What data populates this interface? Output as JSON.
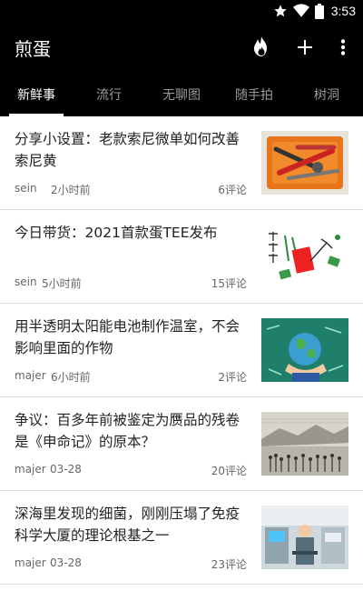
{
  "status_bar": {
    "time": "3:53",
    "icons": [
      "star-icon",
      "wifi-icon",
      "battery-icon"
    ]
  },
  "app_bar": {
    "title": "煎蛋",
    "actions": [
      "flame-icon",
      "plus-icon",
      "more-vert-icon"
    ]
  },
  "tabs": [
    {
      "label": "新鲜事",
      "active": true
    },
    {
      "label": "流行",
      "active": false
    },
    {
      "label": "无聊图",
      "active": false
    },
    {
      "label": "随手拍",
      "active": false
    },
    {
      "label": "树洞",
      "active": false
    }
  ],
  "feed": [
    {
      "title": "分享小设置：老款索尼微单如何改善索尼黄",
      "author": "sein",
      "time": "2小时前",
      "comments": "6评论",
      "thumb": "tools-image"
    },
    {
      "title": "今日带货：2021首款蛋TEE发布",
      "author": "sein",
      "time": "5小时前",
      "comments": "15评论",
      "thumb": "shirt-doodle-image"
    },
    {
      "title": "用半透明太阳能电池制作温室，不会影响里面的作物",
      "author": "majer",
      "time": "6小时前",
      "comments": "2评论",
      "thumb": "globe-hand-image"
    },
    {
      "title": "争议：百多年前被鉴定为赝品的残卷是《申命记》的原本？",
      "author": "majer",
      "time": "03-28",
      "comments": "20评论",
      "thumb": "engraving-image"
    },
    {
      "title": "深海里发现的细菌，刚刚压塌了免疫科学大厦的理论根基之一",
      "author": "majer",
      "time": "03-28",
      "comments": "23评论",
      "thumb": "lab-image"
    }
  ],
  "colors": {
    "bar": "#000000",
    "tab_inactive": "#9a9a9a",
    "meta_text": "#666666",
    "background": "#f2f2f2"
  }
}
